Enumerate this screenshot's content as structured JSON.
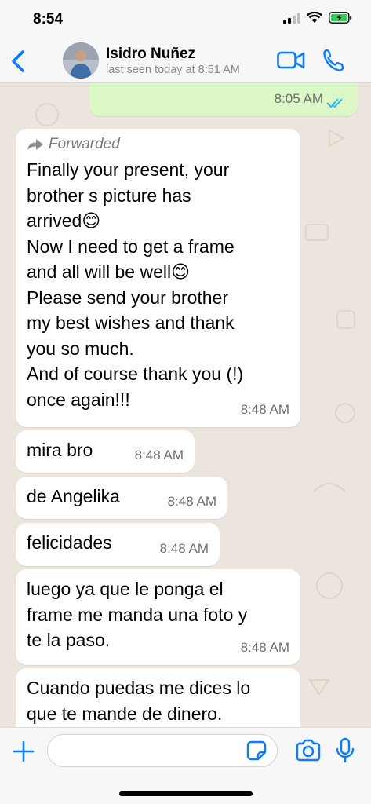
{
  "status_bar": {
    "time": "8:54"
  },
  "header": {
    "contact_name": "Isidro Nuñez",
    "last_seen": "last seen today at 8:51 AM"
  },
  "messages": [
    {
      "direction": "out",
      "text": "",
      "time": "8:05 AM",
      "status": "read"
    },
    {
      "direction": "in",
      "forwarded_label": "Forwarded",
      "text": "Finally your present, your\nbrother s picture has\narrived😊\nNow I need to get a frame\nand all will be well😊\nPlease send your brother\nmy best wishes and thank\nyou so much.\nAnd of course thank you (!)\nonce again!!!",
      "time": "8:48 AM"
    },
    {
      "direction": "in",
      "text": "mira bro",
      "time": "8:48 AM"
    },
    {
      "direction": "in",
      "text": "de Angelika",
      "time": "8:48 AM"
    },
    {
      "direction": "in",
      "text": "felicidades",
      "time": "8:48 AM"
    },
    {
      "direction": "in",
      "text": "luego ya que le ponga el\nframe me manda una foto y\nte la paso.",
      "time": "8:48 AM"
    },
    {
      "direction": "in",
      "text": "Cuando puedas me dices lo\nque te mande de dinero.",
      "time": ""
    }
  ],
  "input": {
    "placeholder": ""
  },
  "colors": {
    "accent": "#0a7cff",
    "outgoing_bubble": "#dcf8c6",
    "chat_bg": "#ece5dd",
    "read_ticks": "#34b7f1"
  }
}
